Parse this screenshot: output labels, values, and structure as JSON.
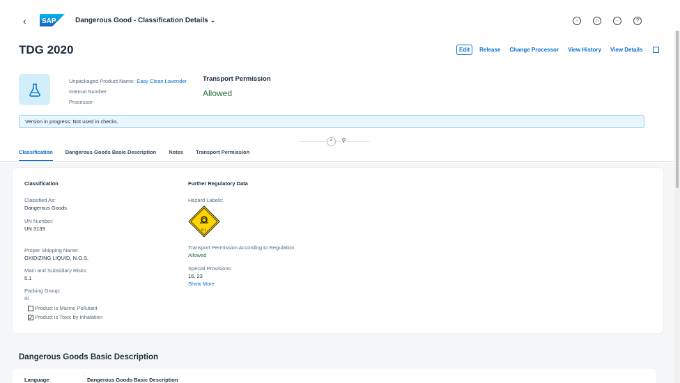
{
  "shell": {
    "logo_text": "SAP",
    "app_title": "Dangerous Good - Classification Details",
    "back_glyph": "‹",
    "icons": [
      "copilot-icon",
      "headset-icon",
      "notifications-icon",
      "help-icon"
    ]
  },
  "header": {
    "title": "TDG 2020",
    "actions": {
      "edit": "Edit",
      "release": "Release",
      "change_processor": "Change Processor",
      "view_history": "View History",
      "view_details": "View Details"
    },
    "attributes": {
      "product_label": "Unpackaged Product Name:",
      "product_value": "Easy Clean Lavender",
      "internal_number_label": "Internal Number:",
      "processor_label": "Processor:"
    },
    "transport_permission": {
      "label": "Transport Permission",
      "value": "Allowed"
    },
    "message": "Version in progress: Not used in checks."
  },
  "tabs": [
    {
      "label": "Classification",
      "active": true
    },
    {
      "label": "Dangerous Goods Basic Description",
      "active": false
    },
    {
      "label": "Notes",
      "active": false
    },
    {
      "label": "Transport Permission",
      "active": false
    }
  ],
  "classification": {
    "title": "Classification",
    "classified_as_label": "Classified As:",
    "classified_as_value": "Dangerous Goods",
    "un_number_label": "UN Number:",
    "un_number_value": "UN 3139",
    "shipping_name_label": "Proper Shipping Name:",
    "shipping_name_value": "OXIDIZING LIQUID, N.O.S.",
    "risks_label": "Main and Subsidiary Risks:",
    "risks_value": "5.1",
    "packing_group_label": "Packing Group:",
    "packing_group_value": "III",
    "marine_pollutant_label": "Product is Marine Pollutant",
    "marine_pollutant_checked": false,
    "toxic_inhalation_label": "Product is Toxic by Inhalation",
    "toxic_inhalation_checked": true
  },
  "regulatory": {
    "title": "Further Regulatory Data",
    "hazard_labels_label": "Hazard Labels:",
    "hazard_label_text": "5.1",
    "hazard_color": "#ffd400",
    "permission_label": "Transport Permission According to Regulation:",
    "permission_value": "Allowed",
    "special_provisions_label": "Special Provisions:",
    "special_provisions_value": "16, 23",
    "show_more": "Show More"
  },
  "basic_description": {
    "heading": "Dangerous Goods Basic Description",
    "columns": [
      "Language",
      "Dangerous Goods Basic Description"
    ]
  },
  "colors": {
    "accent": "#0a6ed1",
    "positive": "#256f3a"
  }
}
